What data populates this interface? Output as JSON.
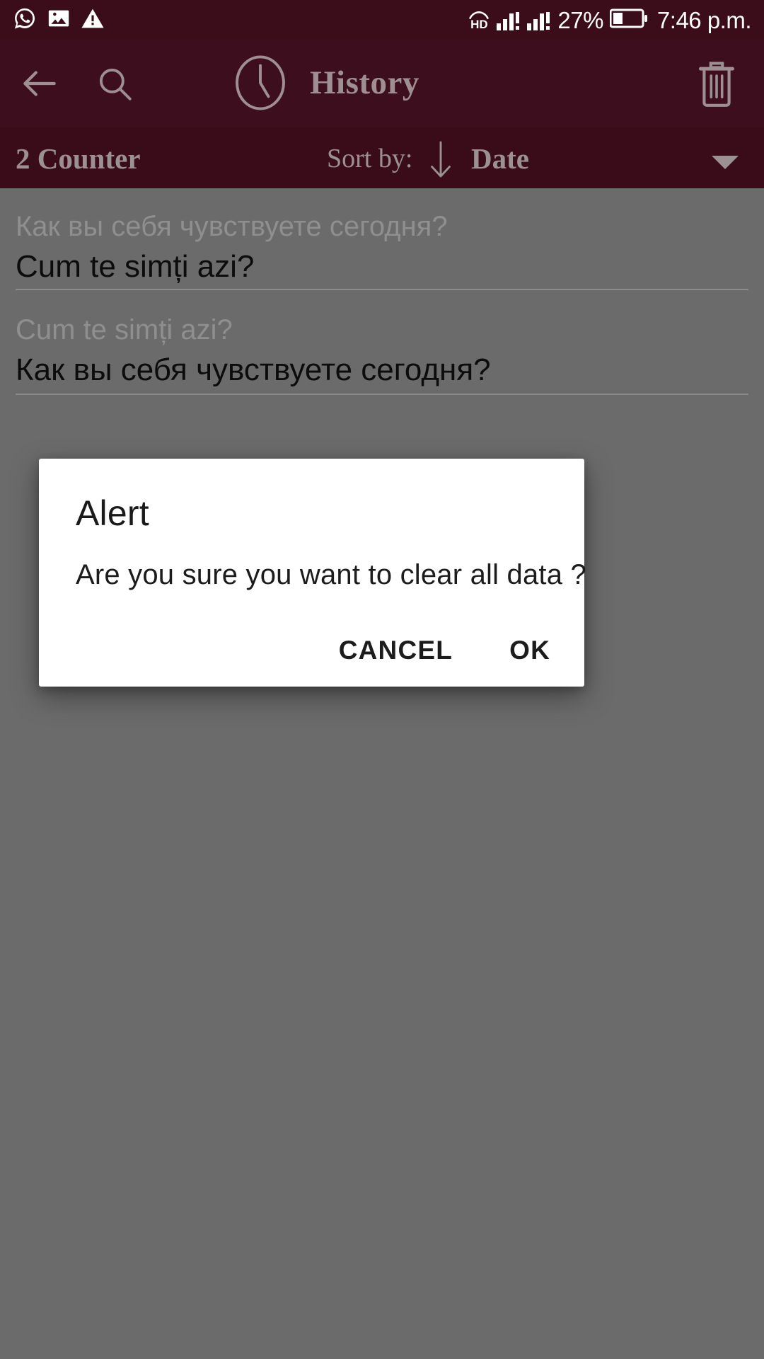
{
  "statusbar": {
    "icons_left": [
      "whatsapp-icon",
      "image-icon",
      "warning-icon"
    ],
    "volte_label": "HD",
    "signal_1": "signal-bars-icon",
    "signal_2": "signal-bars-icon",
    "signal_alert": "!",
    "battery_percent": "27%",
    "battery_icon": "battery-icon",
    "time": "7:46 p.m."
  },
  "appbar": {
    "back_icon": "back-arrow-icon",
    "search_icon": "search-icon",
    "clock_icon": "clock-icon",
    "title": "History",
    "delete_icon": "trash-icon"
  },
  "sortbar": {
    "counter": "2 Counter",
    "sort_label": "Sort by:",
    "sort_direction_icon": "arrow-down-icon",
    "sort_value": "Date",
    "dropdown_icon": "chevron-down-icon"
  },
  "history": {
    "items": [
      {
        "source": "Как вы себя чувствуете сегодня?",
        "translation": "Cum te simți azi?"
      },
      {
        "source": "Cum te simți azi?",
        "translation": "Как вы себя чувствуете сегодня?"
      }
    ]
  },
  "dialog": {
    "title": "Alert",
    "message": "Are you sure you want to clear all data ?",
    "cancel_label": "CANCEL",
    "ok_label": "OK"
  },
  "colors": {
    "statusbar_bg": "#3b0c1a",
    "appbar_bg": "#3d0e1d",
    "sortbar_bg": "#3a0c1a",
    "appbar_fg": "#9e8f93",
    "scrim_bg": "#6b6b6b",
    "dialog_bg": "#ffffff",
    "text_primary": "#0c0c0c",
    "text_secondary": "#8f8f8f"
  }
}
